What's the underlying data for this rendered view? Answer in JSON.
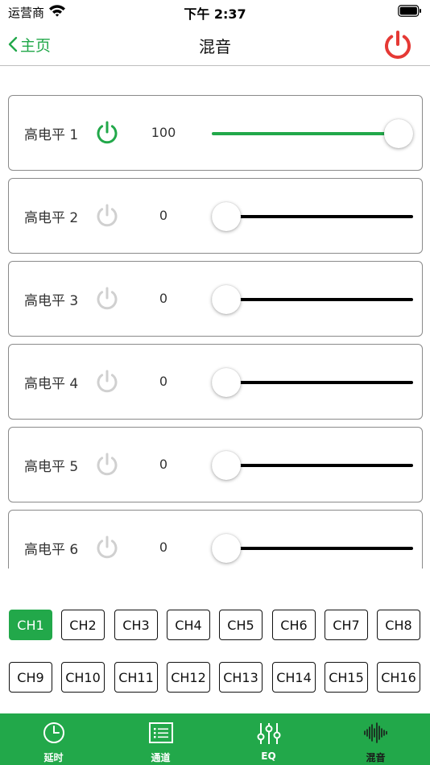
{
  "status_bar": {
    "carrier": "运营商",
    "time": "下午 2:37"
  },
  "nav": {
    "back_label": "主页",
    "title": "混音",
    "power_color": "#e53935"
  },
  "accent_color": "#22a84a",
  "channels": [
    {
      "label": "高电平 1",
      "value": "100",
      "level": 1.0,
      "on": true
    },
    {
      "label": "高电平 2",
      "value": "0",
      "level": 0.0,
      "on": false
    },
    {
      "label": "高电平 3",
      "value": "0",
      "level": 0.0,
      "on": false
    },
    {
      "label": "高电平 4",
      "value": "0",
      "level": 0.0,
      "on": false
    },
    {
      "label": "高电平 5",
      "value": "0",
      "level": 0.0,
      "on": false
    },
    {
      "label": "高电平 6",
      "value": "0",
      "level": 0.0,
      "on": false
    }
  ],
  "ch_buttons": [
    "CH1",
    "CH2",
    "CH3",
    "CH4",
    "CH5",
    "CH6",
    "CH7",
    "CH8",
    "CH9",
    "CH10",
    "CH11",
    "CH12",
    "CH13",
    "CH14",
    "CH15",
    "CH16"
  ],
  "ch_selected": "CH1",
  "tabs": [
    {
      "label": "延时",
      "icon": "clock-icon",
      "active": false
    },
    {
      "label": "通道",
      "icon": "list-icon",
      "active": false
    },
    {
      "label": "EQ",
      "icon": "equalizer-sliders-icon",
      "active": false
    },
    {
      "label": "混音",
      "icon": "waveform-icon",
      "active": true
    }
  ]
}
